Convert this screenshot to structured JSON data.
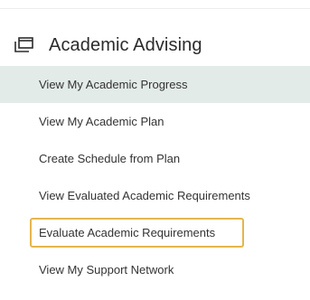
{
  "section": {
    "icon": "window-icon",
    "title": "Academic Advising"
  },
  "menu": {
    "items": [
      {
        "label": "View My Academic Progress",
        "state": "active"
      },
      {
        "label": "View My Academic Plan"
      },
      {
        "label": "Create Schedule from Plan"
      },
      {
        "label": "View Evaluated Academic Requirements"
      },
      {
        "label": "Evaluate Academic Requirements",
        "state": "highlighted"
      },
      {
        "label": "View My Support Network"
      }
    ]
  },
  "colors": {
    "active_background": "#e3ebe9",
    "highlight_border": "#e3b64e",
    "text": "#333333"
  }
}
